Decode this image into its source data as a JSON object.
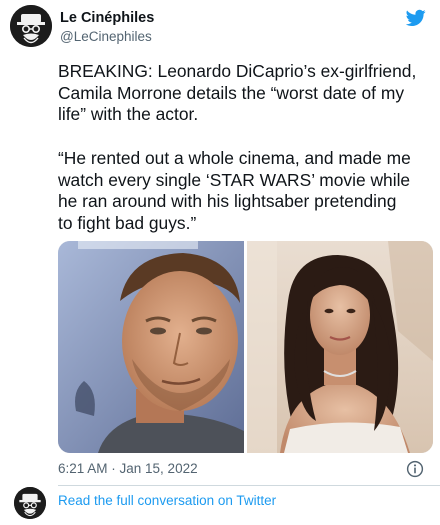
{
  "header": {
    "display_name": "Le Cinéphiles",
    "handle": "@LeCinephiles",
    "brand_icon": "twitter-bird-icon",
    "brand_color": "#1d9bf0"
  },
  "tweet": {
    "paragraph_1": "BREAKING: Leonardo DiCaprio’s ex-girlfriend,\nCamila Morrone details the “worst date of my\nlife” with the actor.",
    "paragraph_2": "“He rented out a whole cinema, and made me\nwatch every single ‘STAR WARS’ movie while\nhe ran around with his lightsaber pretending\nto fight bad guys.”"
  },
  "media": {
    "images": [
      {
        "name": "photo-man"
      },
      {
        "name": "photo-woman"
      }
    ]
  },
  "footer": {
    "timestamp": "6:21 AM · Jan 15, 2022",
    "info_icon": "info-icon",
    "conversation_link": "Read the full conversation on Twitter",
    "link_color": "#1d9bf0"
  }
}
